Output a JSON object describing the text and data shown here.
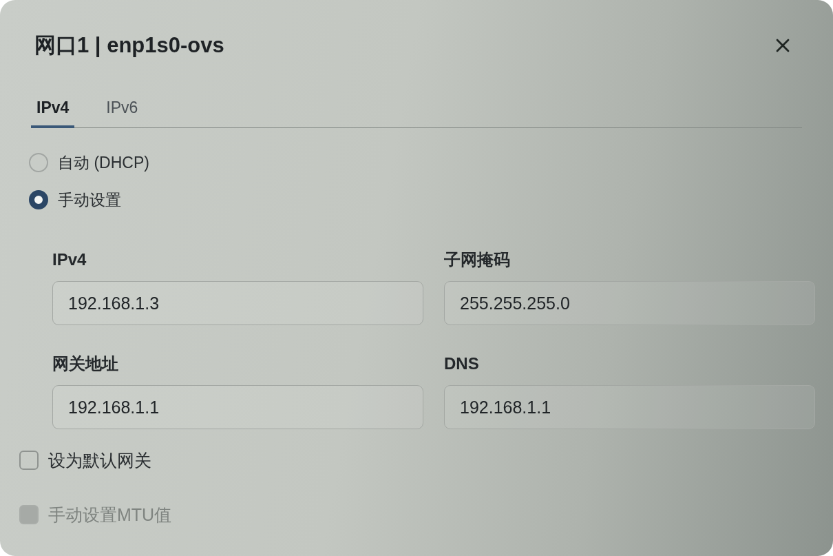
{
  "dialog": {
    "title": "网口1 | enp1s0-ovs"
  },
  "tabs": [
    {
      "label": "IPv4",
      "selected": true
    },
    {
      "label": "IPv6",
      "selected": false
    }
  ],
  "ip_mode": [
    {
      "label": "自动 (DHCP)",
      "selected": false
    },
    {
      "label": "手动设置",
      "selected": true
    }
  ],
  "fields": [
    {
      "label": "IPv4",
      "value": "192.168.1.3"
    },
    {
      "label": "子网掩码",
      "value": "255.255.255.0"
    },
    {
      "label": "网关地址",
      "value": "192.168.1.1"
    },
    {
      "label": "DNS",
      "value": "192.168.1.1"
    }
  ],
  "options": [
    {
      "label": "设为默认网关",
      "checked": false,
      "disabled": false
    },
    {
      "label": "手动设置MTU值",
      "checked": false,
      "disabled": true
    }
  ]
}
